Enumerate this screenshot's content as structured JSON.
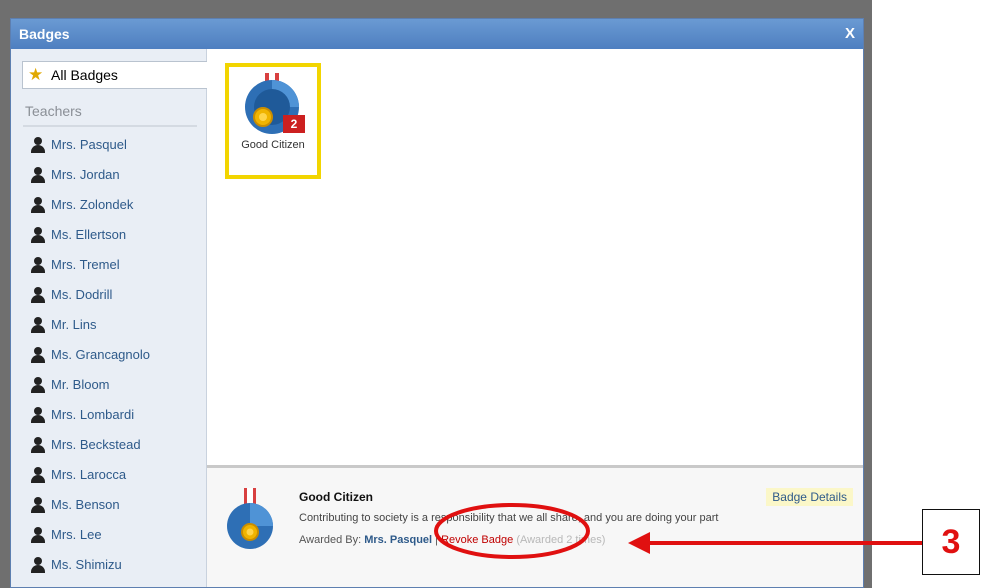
{
  "modal": {
    "title": "Badges",
    "close_label": "X"
  },
  "sidebar": {
    "all_badges_label": "All Badges",
    "section_title": "Teachers",
    "teachers": [
      "Mrs. Pasquel",
      "Mrs. Jordan",
      "Mrs. Zolondek",
      "Ms. Ellertson",
      "Mrs. Tremel",
      "Ms. Dodrill",
      "Mr. Lins",
      "Ms. Grancagnolo",
      "Mr. Bloom",
      "Mrs. Lombardi",
      "Mrs. Beckstead",
      "Mrs. Larocca",
      "Ms. Benson",
      "Mrs. Lee",
      "Ms. Shimizu"
    ]
  },
  "badges": [
    {
      "name": "Good Citizen",
      "count": "2",
      "selected": true
    }
  ],
  "detail": {
    "title": "Good Citizen",
    "details_button": "Badge Details",
    "description": "Contributing to society is a responsibility that we all share, and you are doing your part",
    "awarded_by_label": "Awarded By:",
    "awarder": "Mrs. Pasquel",
    "separator": "|",
    "revoke_label": "Revoke Badge",
    "awarded_times": "(Awarded 2 times)"
  },
  "annotation": {
    "step_number": "3",
    "color": "#e01010"
  },
  "colors": {
    "titlebar": "#4e7fc0",
    "highlight": "#f2d500",
    "count_badge": "#cc2020"
  },
  "icons": {
    "all_badges": "star-badge-icon",
    "teacher": "person-icon",
    "medal": "medal-icon"
  }
}
